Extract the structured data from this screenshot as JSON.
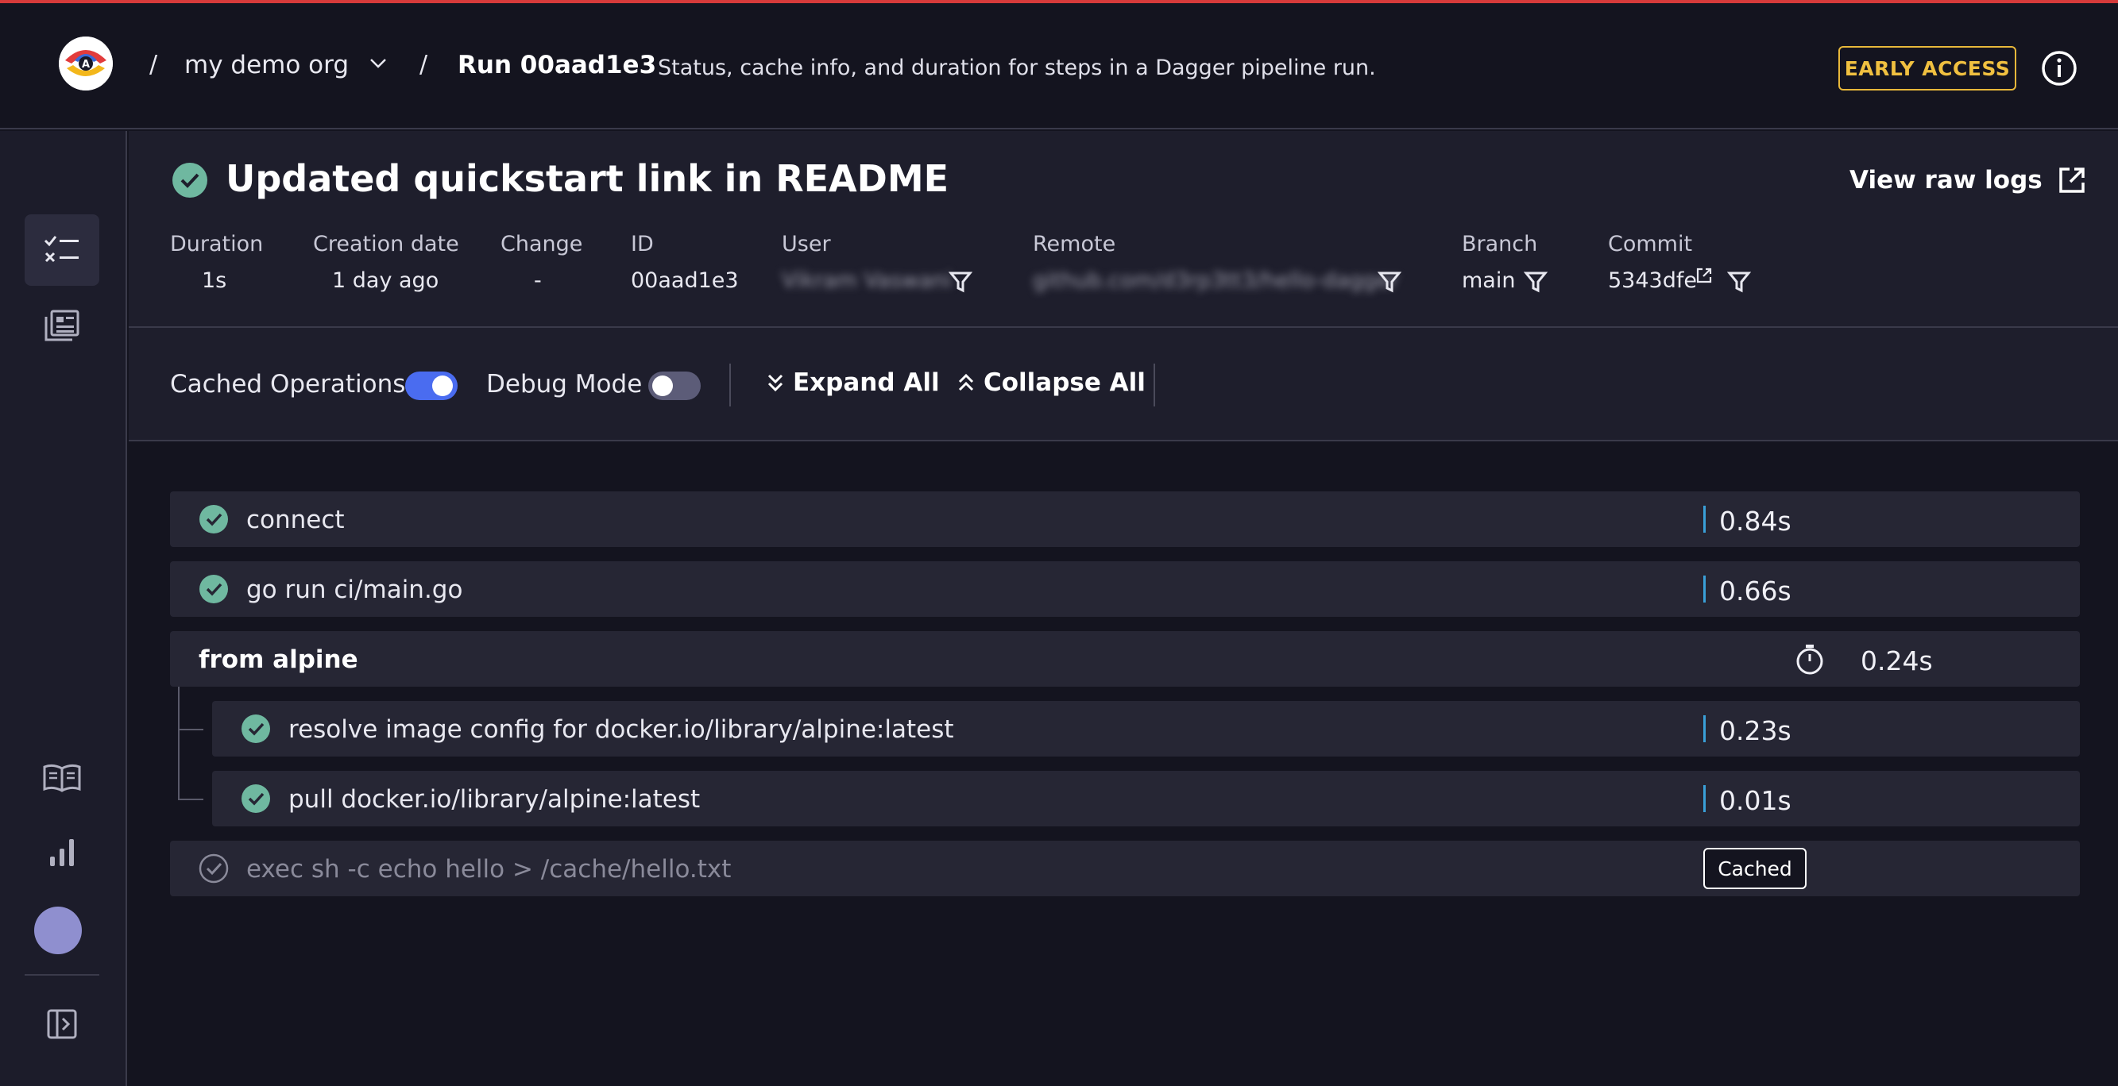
{
  "header": {
    "separator": "/",
    "org_name": "my demo org",
    "run_title": "Run 00aad1e3",
    "run_description": "Status, cache info, and duration for steps in a Dagger pipeline run.",
    "early_access": "EARLY ACCESS"
  },
  "run": {
    "title": "Updated quickstart link in README",
    "view_raw_logs": "View raw logs",
    "meta": {
      "duration_label": "Duration",
      "duration_value": "1s",
      "creation_label": "Creation date",
      "creation_value": "1 day ago",
      "change_label": "Change",
      "change_value": "-",
      "id_label": "ID",
      "id_value": "00aad1e3",
      "user_label": "User",
      "user_value": "Vikram Vaswani",
      "remote_label": "Remote",
      "remote_value": "github.com/d3rp3tt3/hello-dagger",
      "branch_label": "Branch",
      "branch_value": "main",
      "commit_label": "Commit",
      "commit_value": "5343dfe"
    }
  },
  "toolbar": {
    "cached_operations": "Cached Operations",
    "cached_operations_on": true,
    "debug_mode": "Debug Mode",
    "debug_mode_on": false,
    "expand_all": "Expand All",
    "collapse_all": "Collapse All"
  },
  "steps": [
    {
      "name": "connect",
      "duration": "0.84s",
      "status": "success"
    },
    {
      "name": "go run ci/main.go",
      "duration": "0.66s",
      "status": "success"
    },
    {
      "name": "from alpine",
      "duration": "0.24s",
      "status": "group"
    },
    {
      "name": "resolve image config for docker.io/library/alpine:latest",
      "duration": "0.23s",
      "status": "success"
    },
    {
      "name": "pull docker.io/library/alpine:latest",
      "duration": "0.01s",
      "status": "success"
    },
    {
      "name": "exec sh -c echo hello > /cache/hello.txt",
      "badge": "Cached",
      "status": "cached"
    }
  ],
  "colors": {
    "success": "#6fb8a0",
    "accent_toggle": "#4a6cf0",
    "early_access": "#f0c040",
    "duration_bar": "#3aa0d8"
  },
  "icons": {
    "sidebar": [
      "checklist-icon",
      "logs-icon",
      "book-icon",
      "chart-icon",
      "avatar",
      "sidebar-toggle-icon"
    ]
  }
}
